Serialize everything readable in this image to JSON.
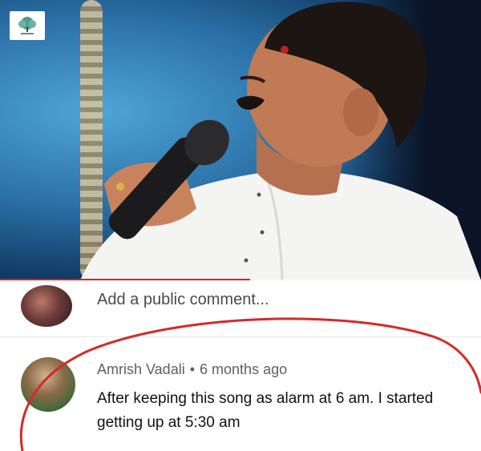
{
  "video": {
    "channel_logo_icon": "tree-logo-icon",
    "progress_fraction": 0.52,
    "progress_color": "#e02020"
  },
  "add_comment": {
    "placeholder": "Add a public comment..."
  },
  "comment": {
    "author": "Amrish Vadali",
    "separator": "•",
    "time": "6 months ago",
    "text": "After keeping this song as alarm at 6 am. I started getting up at 5:30 am"
  },
  "annotation": {
    "color": "#d42a2a"
  }
}
